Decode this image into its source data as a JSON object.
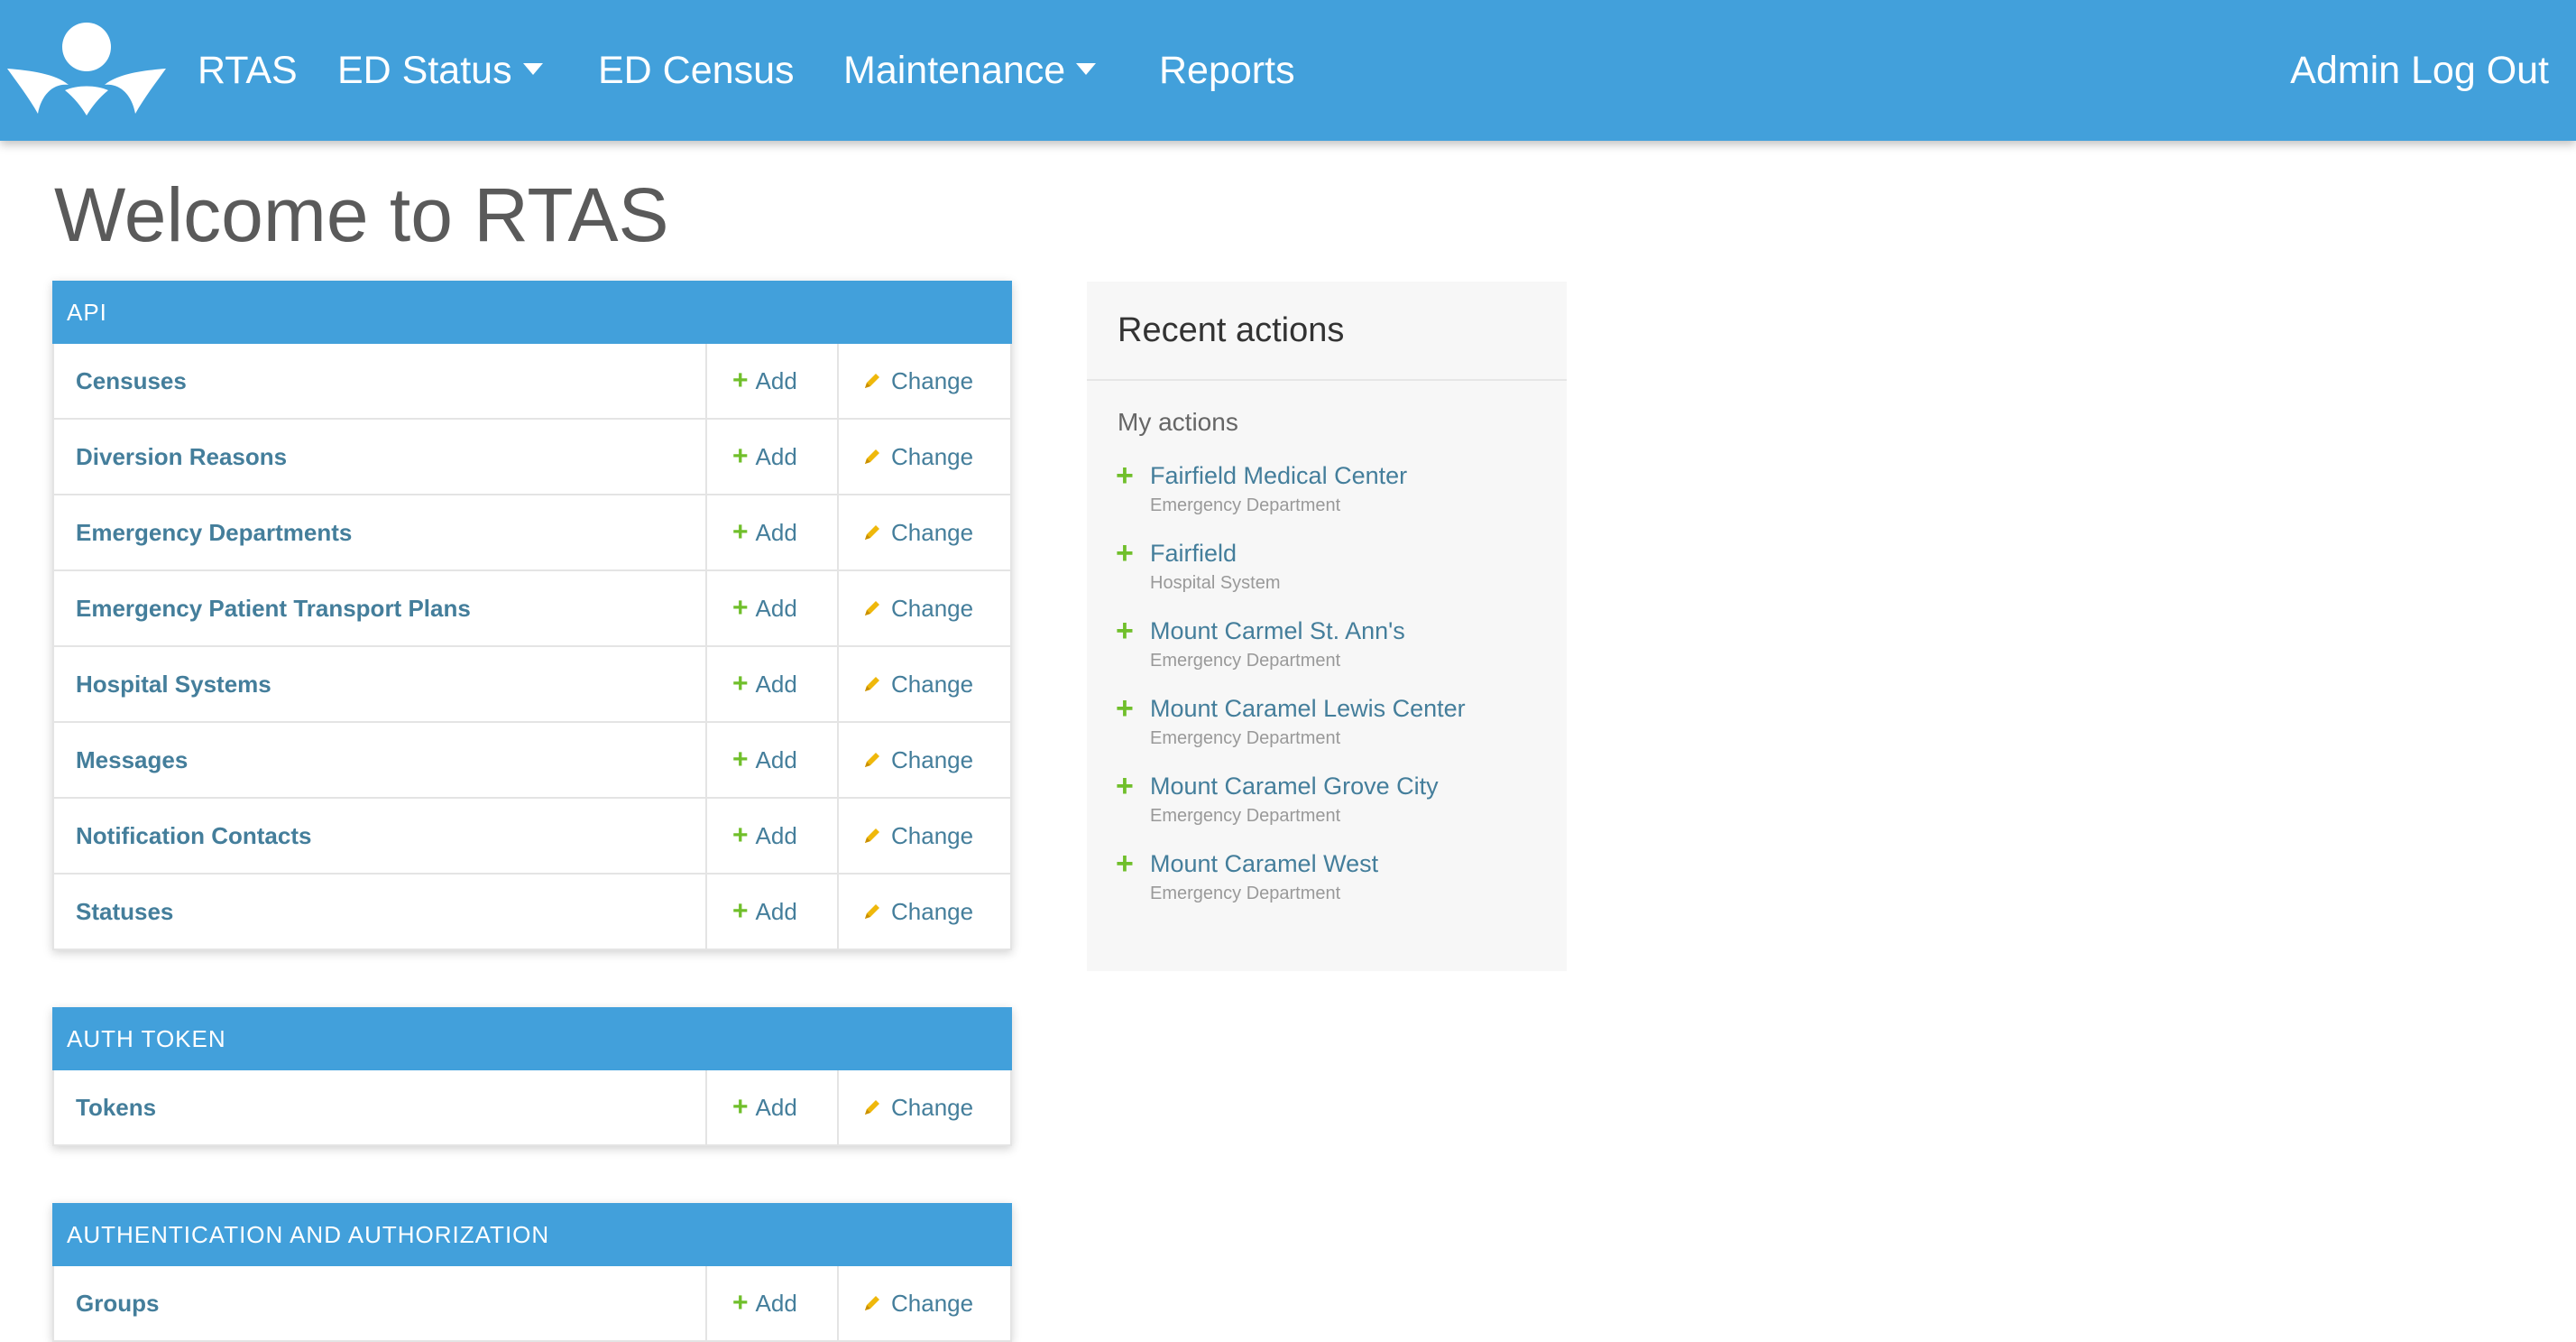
{
  "navbar": {
    "brand": "RTAS",
    "ed_status": "ED Status",
    "ed_census": "ED Census",
    "maintenance": "Maintenance",
    "reports": "Reports",
    "logout": "Admin Log Out"
  },
  "page": {
    "title": "Welcome to RTAS"
  },
  "modules": [
    {
      "header": "API",
      "rows": [
        {
          "name": "Censuses",
          "add": "Add",
          "change": "Change"
        },
        {
          "name": "Diversion Reasons",
          "add": "Add",
          "change": "Change"
        },
        {
          "name": "Emergency Departments",
          "add": "Add",
          "change": "Change"
        },
        {
          "name": "Emergency Patient Transport Plans",
          "add": "Add",
          "change": "Change"
        },
        {
          "name": "Hospital Systems",
          "add": "Add",
          "change": "Change"
        },
        {
          "name": "Messages",
          "add": "Add",
          "change": "Change"
        },
        {
          "name": "Notification Contacts",
          "add": "Add",
          "change": "Change"
        },
        {
          "name": "Statuses",
          "add": "Add",
          "change": "Change"
        }
      ]
    },
    {
      "header": "AUTH TOKEN",
      "rows": [
        {
          "name": "Tokens",
          "add": "Add",
          "change": "Change"
        }
      ]
    },
    {
      "header": "AUTHENTICATION AND AUTHORIZATION",
      "rows": [
        {
          "name": "Groups",
          "add": "Add",
          "change": "Change"
        }
      ]
    }
  ],
  "recent": {
    "title": "Recent actions",
    "subtitle": "My actions",
    "actions": [
      {
        "name": "Fairfield Medical Center",
        "type": "Emergency Department"
      },
      {
        "name": "Fairfield",
        "type": "Hospital System"
      },
      {
        "name": "Mount Carmel St. Ann's",
        "type": "Emergency Department"
      },
      {
        "name": "Mount Caramel Lewis Center",
        "type": "Emergency Department"
      },
      {
        "name": "Mount Caramel Grove City",
        "type": "Emergency Department"
      },
      {
        "name": "Mount Caramel West",
        "type": "Emergency Department"
      }
    ]
  },
  "icons": {
    "logo": "logo-icon",
    "add": "plus-icon",
    "change": "pencil-icon",
    "dropdown": "caret-down-icon"
  },
  "colors": {
    "navbar": "#42a0db",
    "link": "#447e9b",
    "add_icon": "#70bf2b",
    "change_icon": "#efb80b"
  }
}
